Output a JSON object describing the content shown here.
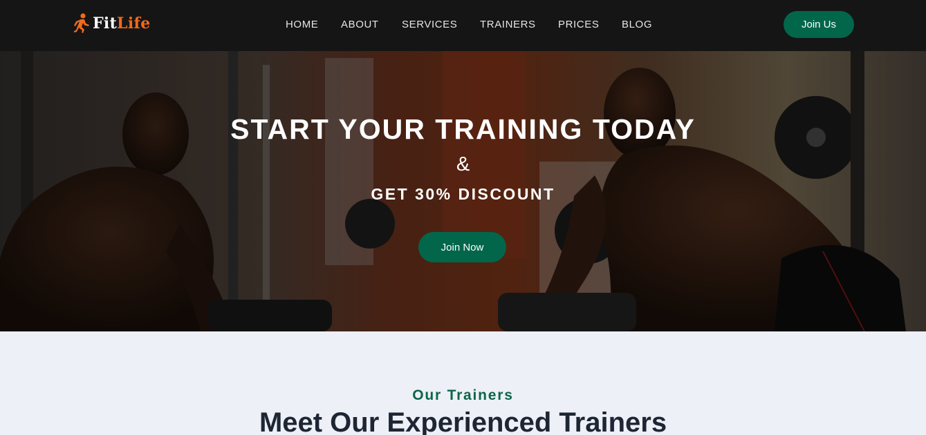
{
  "brand": {
    "name_part1": "Fit",
    "name_part2": "Life",
    "accent_color": "#f26a1b",
    "logo_icon": "running-person-icon"
  },
  "nav": {
    "links": [
      {
        "label": "HOME"
      },
      {
        "label": "ABOUT"
      },
      {
        "label": "SERVICES"
      },
      {
        "label": "TRAINERS"
      },
      {
        "label": "PRICES"
      },
      {
        "label": "BLOG"
      }
    ],
    "cta_label": "Join Us"
  },
  "hero": {
    "title": "START YOUR TRAINING TODAY",
    "ampersand": "&",
    "subtitle": "GET 30% DISCOUNT",
    "cta_label": "Join Now",
    "background": "gym photo of athlete training in front of mirror"
  },
  "trainers": {
    "tag": "Our Trainers",
    "heading": "Meet Our Experienced Trainers"
  },
  "colors": {
    "navbar_bg": "#151515",
    "primary_green": "#02664a",
    "section_bg": "#edf0f7",
    "heading_dark": "#1f2633"
  }
}
